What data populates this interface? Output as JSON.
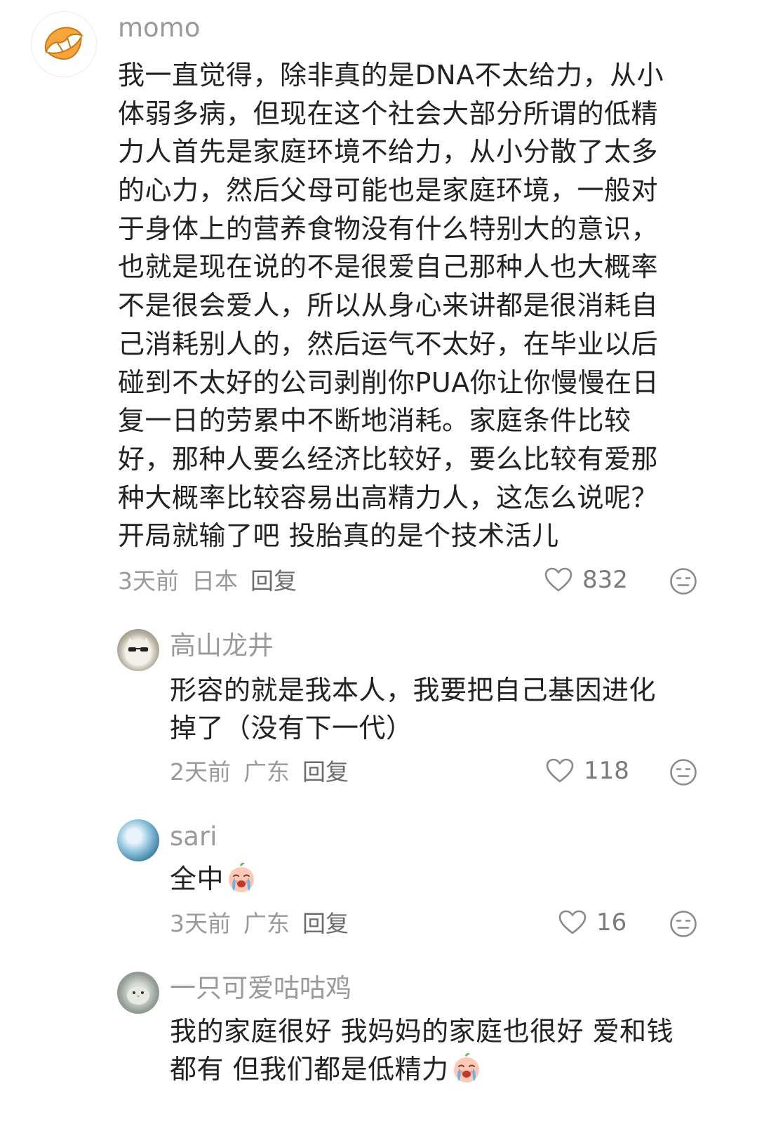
{
  "comments": [
    {
      "username": "momo",
      "avatar_icon": "croissant-icon",
      "lines": [
        "我一直觉得，除非真的是DNA不太给力，从小",
        "体弱多病，但现在这个社会大部分所谓的低精",
        "力人首先是家庭环境不给力，从小分散了太多",
        "的心力，然后父母可能也是家庭环境，一般对",
        "于身体上的营养食物没有什么特别大的意识，",
        "也就是现在说的不是很爱自己那种人也大概率",
        "不是很会爱人，所以从身心来讲都是很消耗自",
        "己消耗别人的，然后运气不太好，在毕业以后",
        "碰到不太好的公司剥削你PUA你让你慢慢在日",
        "复一日的劳累中不断地消耗。家庭条件比较",
        "好，那种人要么经济比较好，要么比较有爱那",
        "种大概率比较容易出高精力人，这怎么说呢？",
        "开局就输了吧 投胎真的是个技术活儿"
      ],
      "time": "3天前",
      "location": "日本",
      "reply_label": "回复",
      "likes": "832"
    }
  ],
  "replies": [
    {
      "username": "高山龙井",
      "lines": [
        "形容的就是我本人，我要把自己基因进化",
        "掉了（没有下一代）"
      ],
      "time": "2天前",
      "location": "广东",
      "reply_label": "回复",
      "likes": "118"
    },
    {
      "username": "sari",
      "lines": [
        "全中"
      ],
      "emoji": "crying-face-emoji",
      "time": "3天前",
      "location": "广东",
      "reply_label": "回复",
      "likes": "16"
    },
    {
      "username": "一只可爱咕咕鸡",
      "lines": [
        "我的家庭很好 我妈妈的家庭也很好 爱和钱",
        "都有 但我们都是低精力"
      ],
      "emoji": "crying-face-emoji"
    }
  ],
  "colors": {
    "text": "#222222",
    "meta": "#9a9a9a",
    "username": "#9a9a9a",
    "croissant": "#f6a53a"
  }
}
